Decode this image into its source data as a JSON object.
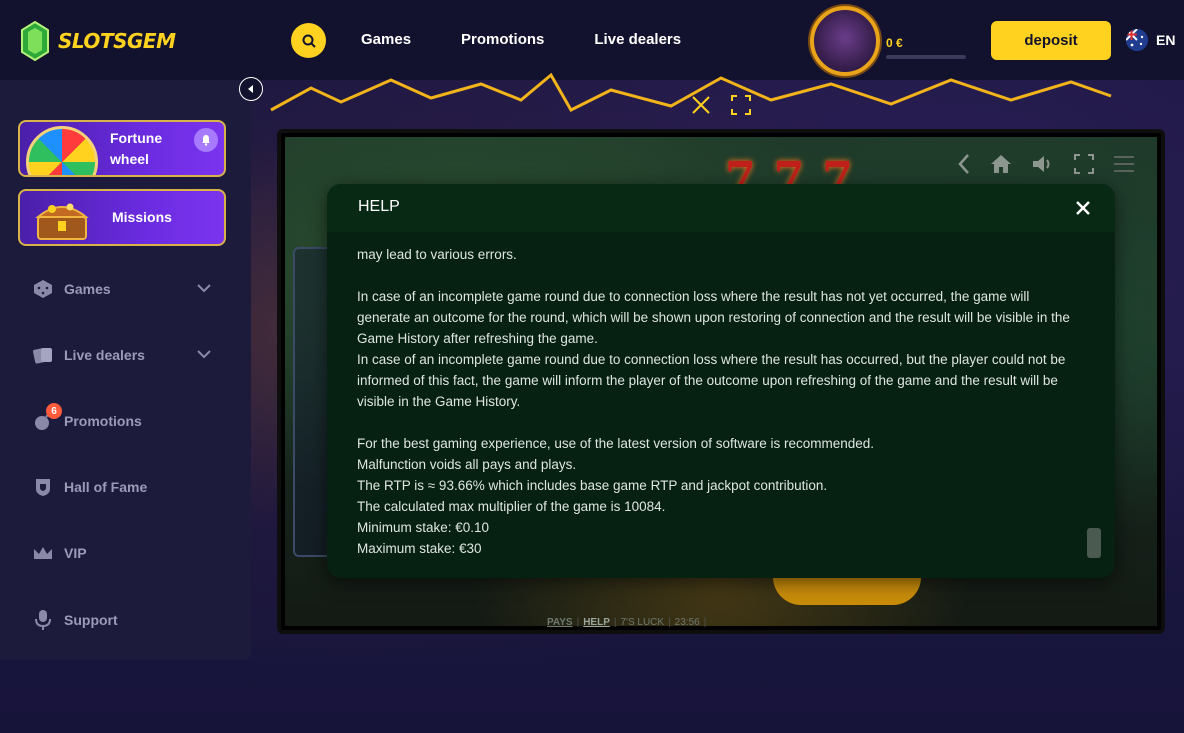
{
  "brand": {
    "name": "SLOTSGEM",
    "accent": "#ffd21f",
    "background": "#16143a",
    "sidebar_bg": "#1c1b3c"
  },
  "header": {
    "search_icon": "search-icon",
    "nav": [
      "Games",
      "Promotions",
      "Live dealers"
    ],
    "balance": "0 €",
    "balance_progress": 0,
    "deposit_label": "deposit",
    "language": "EN"
  },
  "sidebar": {
    "promo_cards": [
      {
        "label": "Fortune wheel"
      },
      {
        "label": "Missions"
      }
    ],
    "items": [
      {
        "label": "Games",
        "icon": "dice-icon",
        "expandable": true
      },
      {
        "label": "Live dealers",
        "icon": "cards-icon",
        "expandable": true
      },
      {
        "label": "Promotions",
        "icon": "bomb-icon",
        "badge": "6"
      },
      {
        "label": "Hall of Fame",
        "icon": "shield-icon"
      },
      {
        "label": "VIP",
        "icon": "crown-icon"
      },
      {
        "label": "Support",
        "icon": "microphone-icon"
      }
    ]
  },
  "game": {
    "footer_links": [
      "PAYS",
      "HELP"
    ],
    "footer_text": [
      "7'S LUCK",
      "23:56"
    ],
    "active_link": "HELP"
  },
  "help_modal": {
    "title": "HELP",
    "paragraphs": [
      [
        "may lead to various errors."
      ],
      [
        "In case of an incomplete game round due to connection loss where the result has not yet occurred, the game will generate an outcome for the round, which will be shown upon restoring of connection and the result will be visible in the Game History after refreshing the game.",
        "In case of an incomplete game round due to connection loss where the result has occurred, but the player could not be informed of this fact, the game will inform the player of the outcome upon refreshing of the game and the result will be visible in the Game History."
      ],
      [
        "For the best gaming experience, use of the latest version of software is recommended.",
        "Malfunction voids all pays and plays.",
        "The RTP is ≈ 93.66% which includes base game RTP and jackpot contribution.",
        "The calculated max multiplier of the game is 10084.",
        "Minimum stake: €0.10",
        "Maximum stake: €30"
      ]
    ]
  }
}
